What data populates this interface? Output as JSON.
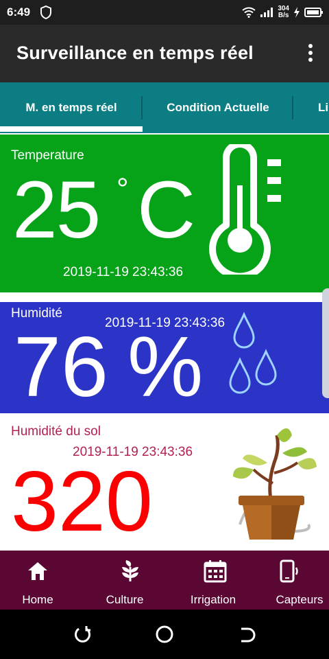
{
  "status_bar": {
    "time": "6:49",
    "net_speed_value": "304",
    "net_speed_unit": "B/s"
  },
  "app_bar": {
    "title": "Surveillance en temps réel"
  },
  "tabs": [
    {
      "label": "M. en temps réel",
      "selected": true
    },
    {
      "label": "Condition Actuelle",
      "selected": false
    },
    {
      "label": "Li",
      "selected": false
    }
  ],
  "temperature": {
    "label": "Temperature",
    "value": "25",
    "degree": "°",
    "unit": "C",
    "timestamp": "2019-11-19 23:43:36",
    "color": "#06a318"
  },
  "humidity": {
    "label": "Humidité",
    "value": "76",
    "unit": "%",
    "timestamp": "2019-11-19 23:43:36",
    "color": "#2b34c6"
  },
  "soil_humidity": {
    "label": "Humidité du sol",
    "value": "320",
    "timestamp": "2019-11-19 23:43:36",
    "value_color": "#fb0000"
  },
  "bottom_nav": [
    {
      "label": "Home",
      "icon": "home-icon"
    },
    {
      "label": "Culture",
      "icon": "leaf-icon"
    },
    {
      "label": "Irrigation",
      "icon": "calendar-icon"
    },
    {
      "label": "Capteurs",
      "icon": "phone-vibrate-icon"
    }
  ],
  "colors": {
    "app_bar": "#2a2a2a",
    "tab_bar": "#0b7d83",
    "bottom_nav": "#5a0734"
  }
}
